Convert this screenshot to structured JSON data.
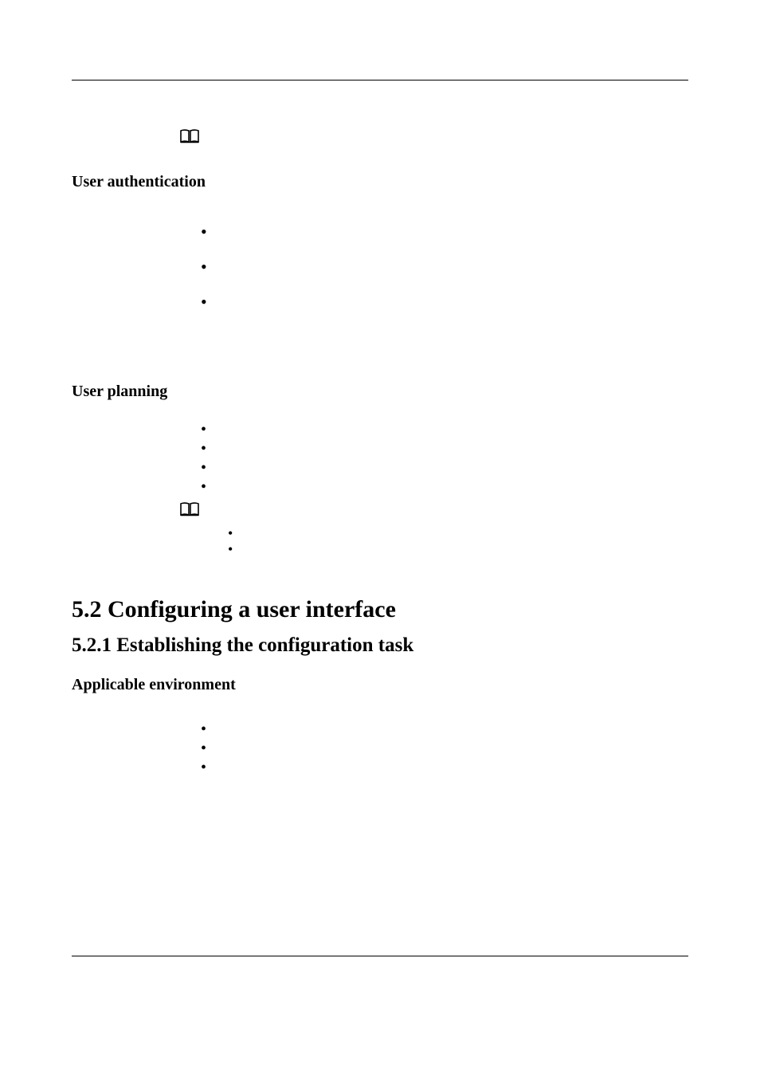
{
  "headings": {
    "user_auth": "User authentication",
    "user_planning": "User planning",
    "sec_5_2": "5.2 Configuring a user interface",
    "sec_5_2_1": "5.2.1 Establishing the configuration task",
    "applicable_env": "Applicable environment"
  },
  "icons": {
    "note1": "book-open-icon",
    "note2": "book-open-icon"
  },
  "bullets": {
    "auth": [
      "•",
      "•",
      "•"
    ],
    "planning": [
      "•",
      "•",
      "•",
      "•"
    ],
    "planning_sub": [
      "•",
      "•"
    ],
    "env": [
      "•",
      "•",
      "•"
    ]
  }
}
